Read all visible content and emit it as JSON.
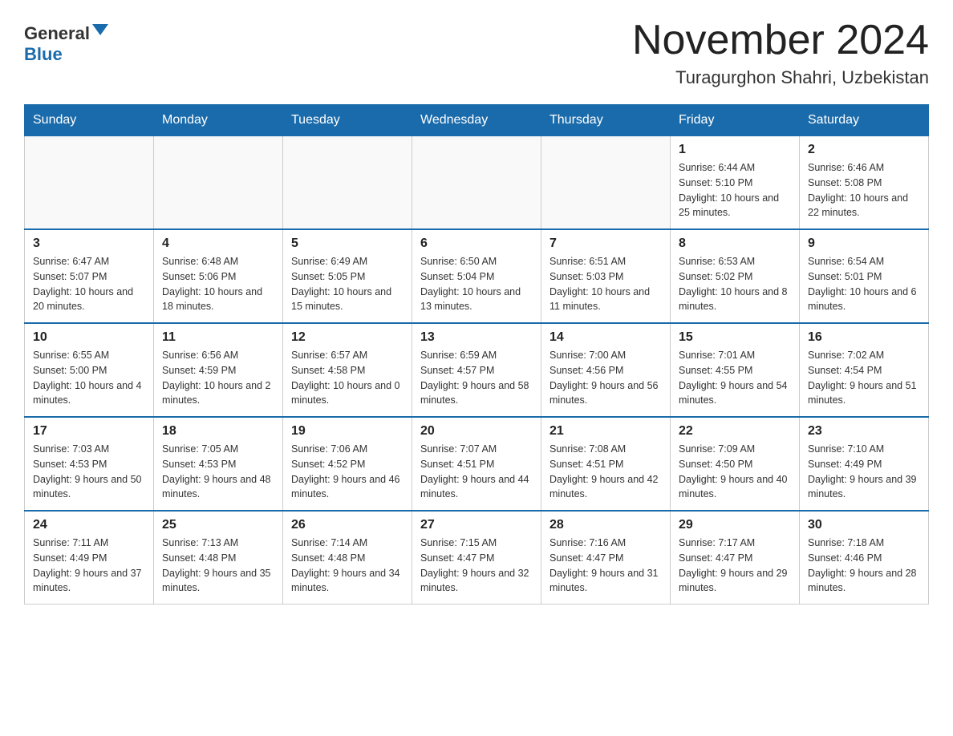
{
  "logo": {
    "text1": "General",
    "text2": "Blue"
  },
  "header": {
    "month": "November 2024",
    "location": "Turagurghon Shahri, Uzbekistan"
  },
  "days_of_week": [
    "Sunday",
    "Monday",
    "Tuesday",
    "Wednesday",
    "Thursday",
    "Friday",
    "Saturday"
  ],
  "weeks": [
    [
      {
        "day": "",
        "info": ""
      },
      {
        "day": "",
        "info": ""
      },
      {
        "day": "",
        "info": ""
      },
      {
        "day": "",
        "info": ""
      },
      {
        "day": "",
        "info": ""
      },
      {
        "day": "1",
        "info": "Sunrise: 6:44 AM\nSunset: 5:10 PM\nDaylight: 10 hours and 25 minutes."
      },
      {
        "day": "2",
        "info": "Sunrise: 6:46 AM\nSunset: 5:08 PM\nDaylight: 10 hours and 22 minutes."
      }
    ],
    [
      {
        "day": "3",
        "info": "Sunrise: 6:47 AM\nSunset: 5:07 PM\nDaylight: 10 hours and 20 minutes."
      },
      {
        "day": "4",
        "info": "Sunrise: 6:48 AM\nSunset: 5:06 PM\nDaylight: 10 hours and 18 minutes."
      },
      {
        "day": "5",
        "info": "Sunrise: 6:49 AM\nSunset: 5:05 PM\nDaylight: 10 hours and 15 minutes."
      },
      {
        "day": "6",
        "info": "Sunrise: 6:50 AM\nSunset: 5:04 PM\nDaylight: 10 hours and 13 minutes."
      },
      {
        "day": "7",
        "info": "Sunrise: 6:51 AM\nSunset: 5:03 PM\nDaylight: 10 hours and 11 minutes."
      },
      {
        "day": "8",
        "info": "Sunrise: 6:53 AM\nSunset: 5:02 PM\nDaylight: 10 hours and 8 minutes."
      },
      {
        "day": "9",
        "info": "Sunrise: 6:54 AM\nSunset: 5:01 PM\nDaylight: 10 hours and 6 minutes."
      }
    ],
    [
      {
        "day": "10",
        "info": "Sunrise: 6:55 AM\nSunset: 5:00 PM\nDaylight: 10 hours and 4 minutes."
      },
      {
        "day": "11",
        "info": "Sunrise: 6:56 AM\nSunset: 4:59 PM\nDaylight: 10 hours and 2 minutes."
      },
      {
        "day": "12",
        "info": "Sunrise: 6:57 AM\nSunset: 4:58 PM\nDaylight: 10 hours and 0 minutes."
      },
      {
        "day": "13",
        "info": "Sunrise: 6:59 AM\nSunset: 4:57 PM\nDaylight: 9 hours and 58 minutes."
      },
      {
        "day": "14",
        "info": "Sunrise: 7:00 AM\nSunset: 4:56 PM\nDaylight: 9 hours and 56 minutes."
      },
      {
        "day": "15",
        "info": "Sunrise: 7:01 AM\nSunset: 4:55 PM\nDaylight: 9 hours and 54 minutes."
      },
      {
        "day": "16",
        "info": "Sunrise: 7:02 AM\nSunset: 4:54 PM\nDaylight: 9 hours and 51 minutes."
      }
    ],
    [
      {
        "day": "17",
        "info": "Sunrise: 7:03 AM\nSunset: 4:53 PM\nDaylight: 9 hours and 50 minutes."
      },
      {
        "day": "18",
        "info": "Sunrise: 7:05 AM\nSunset: 4:53 PM\nDaylight: 9 hours and 48 minutes."
      },
      {
        "day": "19",
        "info": "Sunrise: 7:06 AM\nSunset: 4:52 PM\nDaylight: 9 hours and 46 minutes."
      },
      {
        "day": "20",
        "info": "Sunrise: 7:07 AM\nSunset: 4:51 PM\nDaylight: 9 hours and 44 minutes."
      },
      {
        "day": "21",
        "info": "Sunrise: 7:08 AM\nSunset: 4:51 PM\nDaylight: 9 hours and 42 minutes."
      },
      {
        "day": "22",
        "info": "Sunrise: 7:09 AM\nSunset: 4:50 PM\nDaylight: 9 hours and 40 minutes."
      },
      {
        "day": "23",
        "info": "Sunrise: 7:10 AM\nSunset: 4:49 PM\nDaylight: 9 hours and 39 minutes."
      }
    ],
    [
      {
        "day": "24",
        "info": "Sunrise: 7:11 AM\nSunset: 4:49 PM\nDaylight: 9 hours and 37 minutes."
      },
      {
        "day": "25",
        "info": "Sunrise: 7:13 AM\nSunset: 4:48 PM\nDaylight: 9 hours and 35 minutes."
      },
      {
        "day": "26",
        "info": "Sunrise: 7:14 AM\nSunset: 4:48 PM\nDaylight: 9 hours and 34 minutes."
      },
      {
        "day": "27",
        "info": "Sunrise: 7:15 AM\nSunset: 4:47 PM\nDaylight: 9 hours and 32 minutes."
      },
      {
        "day": "28",
        "info": "Sunrise: 7:16 AM\nSunset: 4:47 PM\nDaylight: 9 hours and 31 minutes."
      },
      {
        "day": "29",
        "info": "Sunrise: 7:17 AM\nSunset: 4:47 PM\nDaylight: 9 hours and 29 minutes."
      },
      {
        "day": "30",
        "info": "Sunrise: 7:18 AM\nSunset: 4:46 PM\nDaylight: 9 hours and 28 minutes."
      }
    ]
  ]
}
